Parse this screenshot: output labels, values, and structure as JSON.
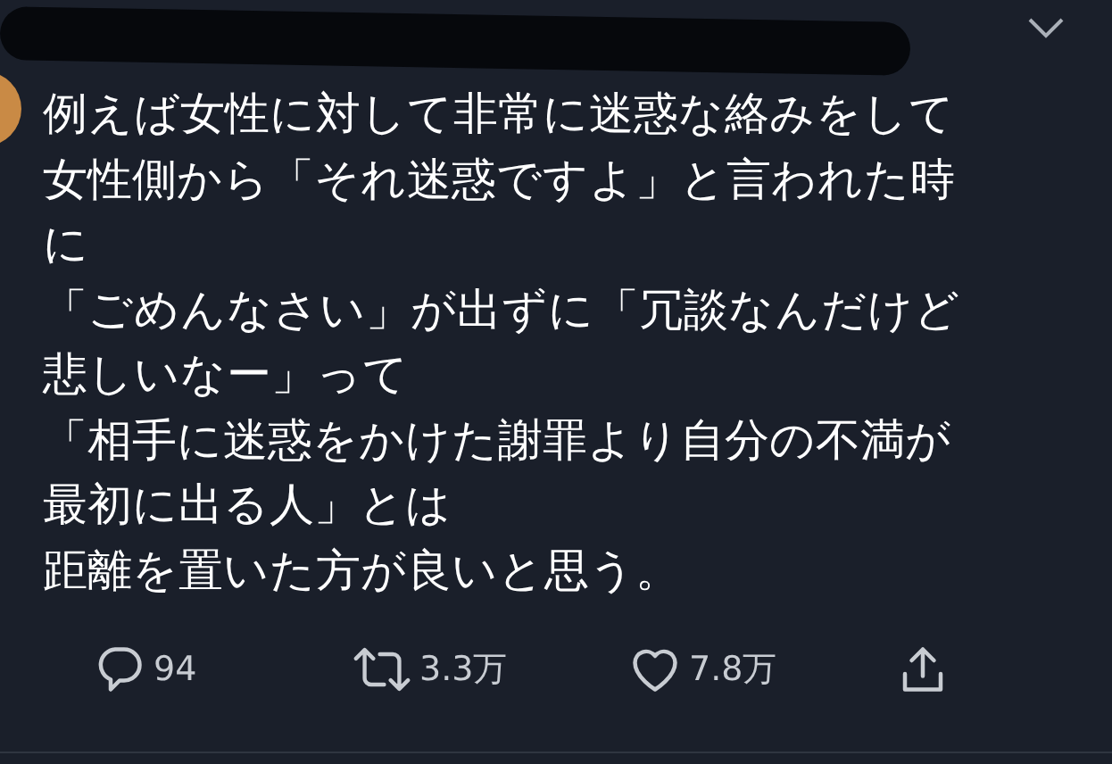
{
  "tweet": {
    "lines": [
      "例えば女性に対して非常に迷惑な絡みをして",
      "女性側から「それ迷惑ですよ」と言われた時",
      "に",
      "「ごめんなさい」が出ずに「冗談なんだけど",
      "悲しいなー」って",
      "「相手に迷惑をかけた謝罪より自分の不満が",
      "最初に出る人」とは",
      "距離を置いた方が良いと思う。"
    ]
  },
  "actions": [
    {
      "kind": "reply",
      "count": "94"
    },
    {
      "kind": "retweet",
      "count": "3.3万"
    },
    {
      "kind": "like",
      "count": "7.8万"
    },
    {
      "kind": "share"
    }
  ]
}
